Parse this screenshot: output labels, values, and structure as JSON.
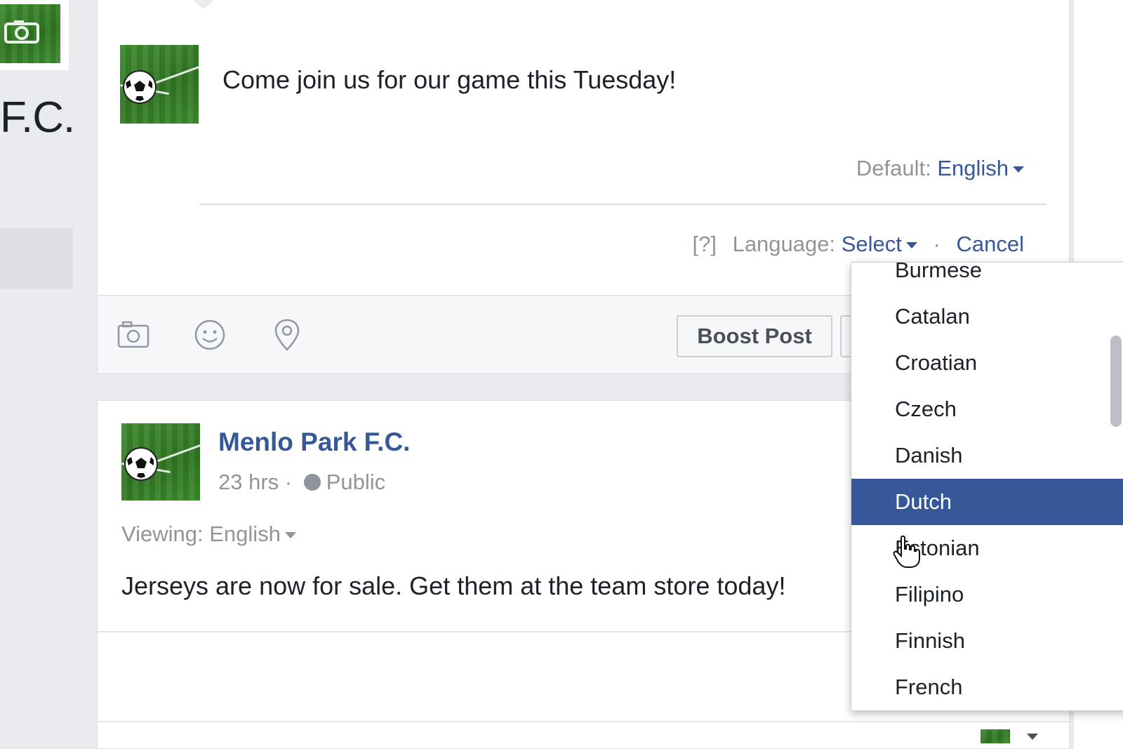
{
  "sidebar": {
    "page_name_fragment": "F.C."
  },
  "composer": {
    "text": "Come join us for our game this Tuesday!",
    "default_language_label": "Default:",
    "default_language_value": "English",
    "help_link": "[?]",
    "language_label": "Language:",
    "language_select": "Select",
    "separator": "·",
    "cancel_label": "Cancel",
    "toolbar_icons": [
      "camera-icon",
      "emoji-icon",
      "location-pin-icon"
    ],
    "boost_post_label": "Boost Post"
  },
  "post": {
    "author": "Menlo Park F.C.",
    "time": "23 hrs",
    "separator": "·",
    "privacy": "Public",
    "viewing_label": "Viewing:",
    "viewing_language": "English",
    "text": "Jerseys are now for sale. Get them at the team store today!"
  },
  "language_dropdown": {
    "options": [
      "Burmese",
      "Catalan",
      "Croatian",
      "Czech",
      "Danish",
      "Dutch",
      "Estonian",
      "Filipino",
      "Finnish",
      "French"
    ],
    "selected": "Dutch"
  },
  "colors": {
    "link_blue": "#365899",
    "selected_bg": "#365899",
    "muted_text": "#90949c",
    "page_bg": "#e9ebee"
  }
}
